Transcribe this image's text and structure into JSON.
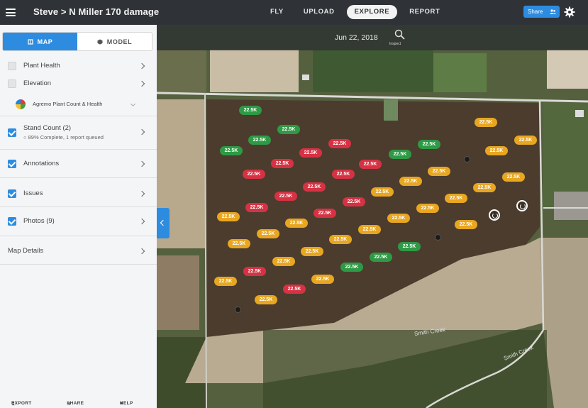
{
  "header": {
    "title": "Steve > N Miller 170 damage",
    "tabs": [
      "FLY",
      "UPLOAD",
      "EXPLORE",
      "REPORT"
    ],
    "active_tab": "EXPLORE",
    "share_label": "Share",
    "colors": {
      "bar": "#2f3338",
      "accent": "#2d8ce0"
    }
  },
  "sidebar": {
    "toggle": {
      "map_label": "MAP",
      "model_label": "MODEL",
      "selected": "MAP"
    },
    "layers": [
      {
        "label": "Plant Health",
        "checked": false
      },
      {
        "label": "Elevation",
        "checked": false
      }
    ],
    "agremo_label": "Agremo Plant Count & Health",
    "stand_count": {
      "label": "Stand Count (2)",
      "status": "89% Complete, 1 report queued",
      "checked": true
    },
    "annotations": {
      "label": "Annotations",
      "checked": true
    },
    "issues": {
      "label": "Issues",
      "checked": true
    },
    "photos": {
      "label": "Photos (9)",
      "checked": true
    },
    "map_details": "Map Details",
    "footer": {
      "export": "EXPORT",
      "share": "SHARE",
      "help": "HELP"
    }
  },
  "map": {
    "date": "Jun 22, 2018",
    "inspect_label": "Inspect",
    "roads": [
      "Smith Creek",
      "Smith Creek"
    ],
    "marker_value": "22.5K",
    "marker_colors": {
      "green": "#2e9a45",
      "red": "#d63244",
      "yellow": "#e8a621"
    }
  }
}
